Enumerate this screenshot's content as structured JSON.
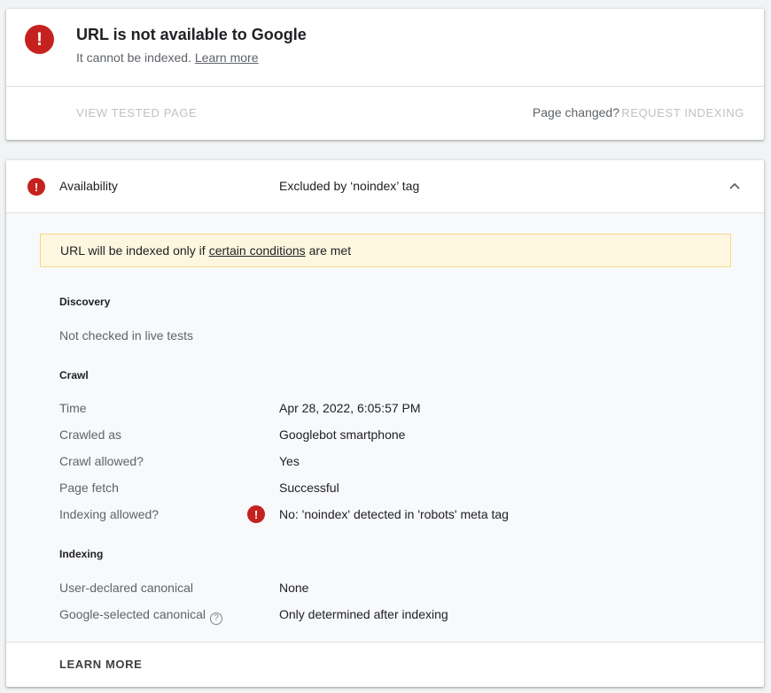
{
  "status": {
    "title": "URL is not available to Google",
    "subtitle": "It cannot be indexed.",
    "learn_more_link": "Learn more",
    "view_tested_page": "VIEW TESTED PAGE",
    "page_changed": "Page changed?",
    "request_indexing": "REQUEST INDEXING",
    "error_color": "#c5221f"
  },
  "availability": {
    "label": "Availability",
    "value": "Excluded by ‘noindex’ tag",
    "notice_prefix": "URL will be indexed only if",
    "notice_link": "certain conditions",
    "notice_suffix": "are met",
    "discovery": {
      "title": "Discovery",
      "text": "Not checked in live tests"
    },
    "crawl": {
      "title": "Crawl",
      "rows": [
        {
          "label": "Time",
          "value": "Apr 28, 2022, 6:05:57 PM"
        },
        {
          "label": "Crawled as",
          "value": "Googlebot smartphone"
        },
        {
          "label": "Crawl allowed?",
          "value": "Yes"
        },
        {
          "label": "Page fetch",
          "value": "Successful"
        },
        {
          "label": "Indexing allowed?",
          "value": "No: 'noindex' detected in 'robots' meta tag"
        }
      ]
    },
    "indexing": {
      "title": "Indexing",
      "rows": [
        {
          "label": "User-declared canonical",
          "value": "None"
        },
        {
          "label": "Google-selected canonical",
          "value": "Only determined after indexing"
        }
      ]
    },
    "learn_more": "LEARN MORE"
  },
  "icons": {
    "error": "error-icon",
    "collapse": "chevron-up-icon",
    "help": "help-circle-icon"
  }
}
